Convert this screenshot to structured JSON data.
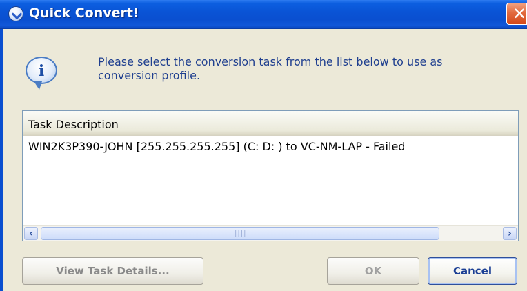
{
  "window": {
    "title": "Quick Convert!",
    "close_glyph": "✕",
    "title_icon": "arrow-circle-icon"
  },
  "message": {
    "icon": "info-icon",
    "icon_glyph": "i",
    "text": "Please select the conversion task from the list below to use as conversion profile."
  },
  "list": {
    "column_header": "Task Description",
    "rows": [
      "WIN2K3P390-JOHN [255.255.255.255] (C: D: ) to VC-NM-LAP - Failed"
    ],
    "scroll_left_glyph": "‹",
    "scroll_right_glyph": "›",
    "thumb_grip": "||||"
  },
  "buttons": {
    "view_details": "View Task Details...",
    "ok": "OK",
    "cancel": "Cancel"
  },
  "colors": {
    "titlebar": "#0a54d6",
    "message_text": "#1f3f8f",
    "dialog_bg": "#ece9d8",
    "close_button": "#d4491a"
  }
}
